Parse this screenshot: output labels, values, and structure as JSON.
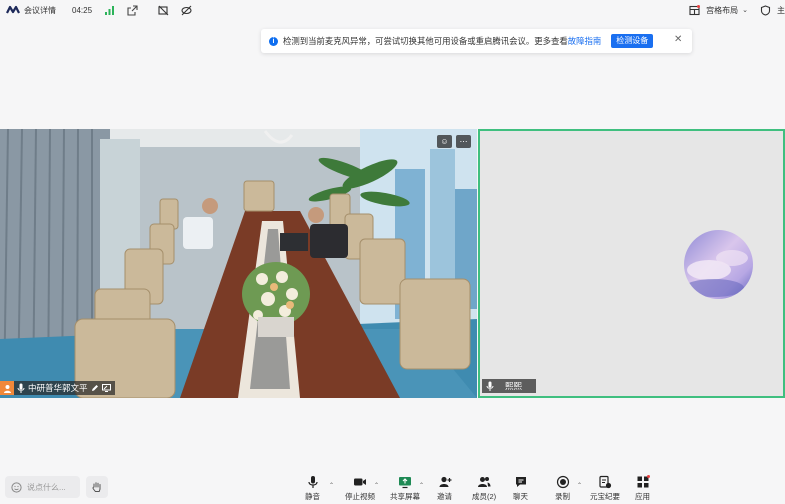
{
  "topbar": {
    "meeting_detail": "会议详情",
    "timer": "04:25",
    "layout": "宫格布局",
    "icons": [
      "logo-icon",
      "signal-icon",
      "popout-icon",
      "no-camera-icon",
      "hidden-icon",
      "layout-icon",
      "shield-icon"
    ],
    "truncated_right": "主"
  },
  "notice": {
    "text": "检测到当前麦克风异常，可尝试切换其他可用设备或重启腾讯会议。更多查看",
    "link": "故障指南",
    "button": "检测设备"
  },
  "tiles": {
    "left_name": "中研普华郭文平",
    "right_name": "熙熙"
  },
  "chat": {
    "placeholder": "说点什么..."
  },
  "toolbar": {
    "mute": "静音",
    "stop_video": "停止视频",
    "share": "共享屏幕",
    "invite": "邀请",
    "members": "成员(2)",
    "chat": "聊天",
    "record": "录制",
    "minutes": "元宝纪要",
    "apps": "应用"
  },
  "colors": {
    "accent": "#1a6ff0",
    "active_speaker_border": "#3fbf7f",
    "host_badge": "#f0883a"
  }
}
